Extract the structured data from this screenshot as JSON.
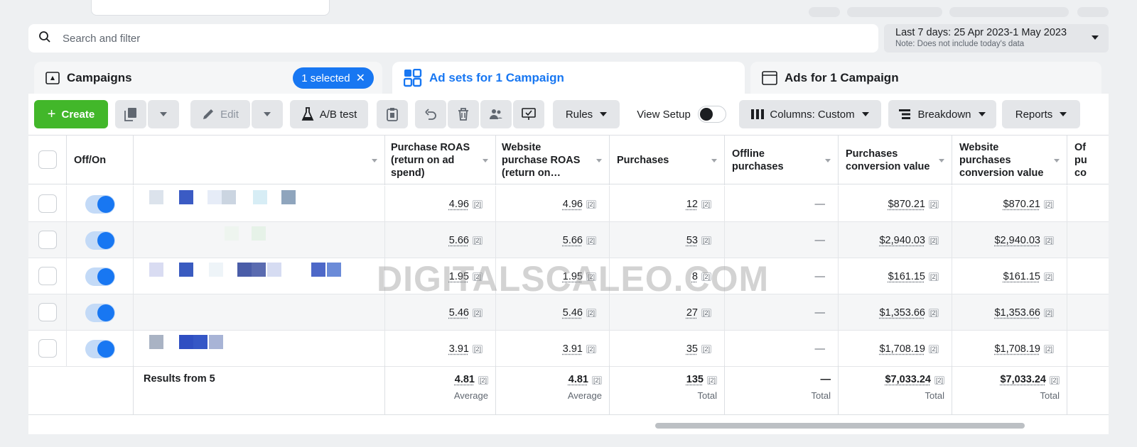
{
  "search": {
    "placeholder": "Search and filter"
  },
  "date_range": {
    "label": "Last 7 days: 25 Apr 2023-1 May 2023",
    "note": "Note: Does not include today's data"
  },
  "tabs": [
    {
      "label": "Campaigns",
      "badge": "1 selected",
      "icon": "campaign-icon"
    },
    {
      "label": "Ad sets for 1 Campaign",
      "icon": "adsets-grid-icon",
      "active": true
    },
    {
      "label": "Ads for 1 Campaign",
      "icon": "ads-window-icon"
    }
  ],
  "toolbar": {
    "create": "Create",
    "edit": "Edit",
    "ab_test": "A/B test",
    "rules": "Rules",
    "view_setup": "View Setup",
    "columns": "Columns: Custom",
    "breakdown": "Breakdown",
    "reports": "Reports"
  },
  "table": {
    "headers": {
      "off_on": "Off/On",
      "name": "",
      "purchase_roas": "Purchase ROAS (return on ad spend)",
      "website_purchase_roas": "Website purchase ROAS (return on…",
      "purchases": "Purchases",
      "offline_purchases": "Offline purchases",
      "purchases_conversion_value": "Purchases conversion value",
      "website_purchases_conversion_value": "Website purchases conversion value",
      "cut_off": "Of pu co"
    },
    "footnote_marker": "[2]",
    "rows": [
      {
        "purchase_roas": "4.96",
        "website_purchase_roas": "4.96",
        "purchases": "12",
        "offline_purchases": "—",
        "purchases_conversion_value": "$870.21",
        "website_purchases_conversion_value": "$870.21"
      },
      {
        "purchase_roas": "5.66",
        "website_purchase_roas": "5.66",
        "purchases": "53",
        "offline_purchases": "—",
        "purchases_conversion_value": "$2,940.03",
        "website_purchases_conversion_value": "$2,940.03"
      },
      {
        "purchase_roas": "1.95",
        "website_purchase_roas": "1.95",
        "purchases": "8",
        "offline_purchases": "—",
        "purchases_conversion_value": "$161.15",
        "website_purchases_conversion_value": "$161.15"
      },
      {
        "purchase_roas": "5.46",
        "website_purchase_roas": "5.46",
        "purchases": "27",
        "offline_purchases": "—",
        "purchases_conversion_value": "$1,353.66",
        "website_purchases_conversion_value": "$1,353.66"
      },
      {
        "purchase_roas": "3.91",
        "website_purchase_roas": "3.91",
        "purchases": "35",
        "offline_purchases": "—",
        "purchases_conversion_value": "$1,708.19",
        "website_purchases_conversion_value": "$1,708.19"
      }
    ],
    "totals": {
      "label": "Results from 5",
      "purchase_roas": "4.81",
      "purchase_roas_sub": "Average",
      "website_purchase_roas": "4.81",
      "website_purchase_roas_sub": "Average",
      "purchases": "135",
      "purchases_sub": "Total",
      "offline_purchases": "—",
      "offline_purchases_sub": "Total",
      "purchases_conversion_value": "$7,033.24",
      "purchases_conversion_value_sub": "Total",
      "website_purchases_conversion_value": "$7,033.24",
      "website_purchases_conversion_value_sub": "Total"
    }
  },
  "watermark": "DIGITALSCALEO.COM",
  "colors": {
    "primary_blue": "#1877f2",
    "create_green": "#42b72a"
  }
}
